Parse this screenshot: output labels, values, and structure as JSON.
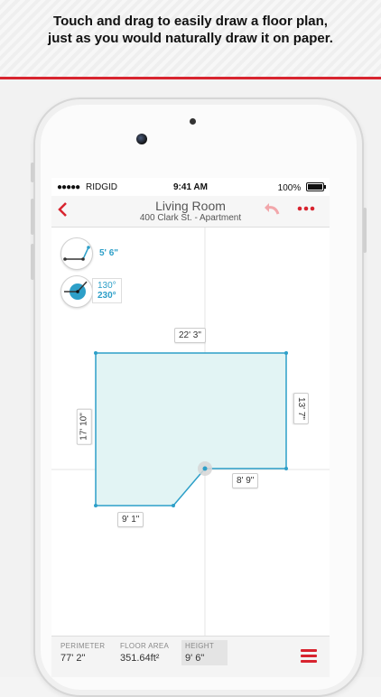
{
  "promo": {
    "line1": "Touch and drag to easily draw a floor plan,",
    "line2": "just as you would naturally draw it on paper."
  },
  "status": {
    "carrier": "RIDGID",
    "signal_dots": "●●●●●",
    "time": "9:41 AM",
    "battery": "100%"
  },
  "nav": {
    "title": "Living Room",
    "subtitle": "400 Clark St. - Apartment",
    "back_icon": "chevron-left-icon",
    "undo_icon": "undo-arrow-icon",
    "more_icon": "more-dots-icon"
  },
  "tools": {
    "length_value": "5' 6\"",
    "angle_values": [
      "130°",
      "230°"
    ]
  },
  "dimensions": {
    "top": "22' 3\"",
    "right": "13' 7\"",
    "left": "17' 10\"",
    "bottom_right": "8' 9\"",
    "bottom": "9' 1\""
  },
  "metrics": [
    {
      "label": "PERIMETER",
      "value": "77' 2\""
    },
    {
      "label": "FLOOR AREA",
      "value": "351.64ft²"
    },
    {
      "label": "HEIGHT",
      "value": "9' 6\""
    }
  ],
  "colors": {
    "accent_red": "#d8242f",
    "plan_blue": "#2d9fc8",
    "plan_fill": "#e2f4f4"
  }
}
